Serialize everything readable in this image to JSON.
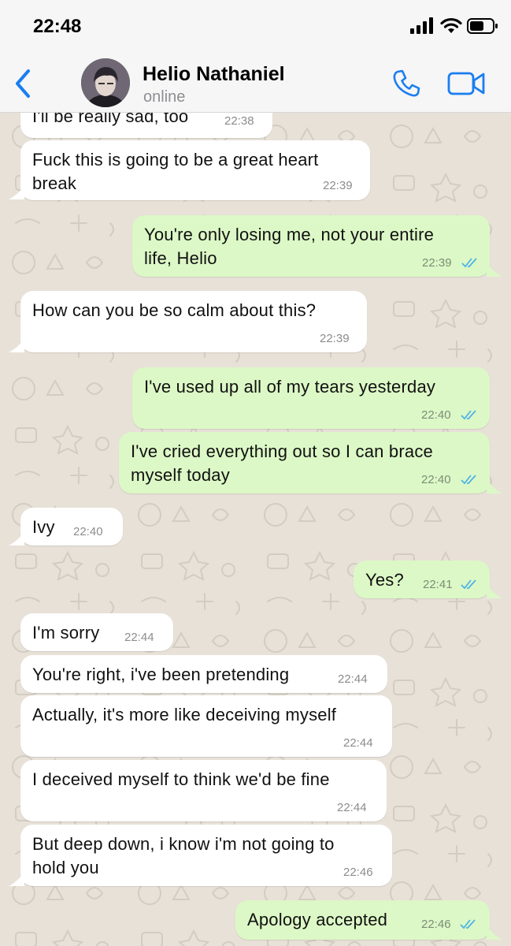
{
  "status_bar": {
    "time": "22:48"
  },
  "header": {
    "contact_name": "Helio Nathaniel",
    "contact_status": "online"
  },
  "icons": [
    "chevron-left-icon",
    "phone-icon",
    "video-camera-icon",
    "signal-icon",
    "wifi-icon",
    "battery-icon",
    "double-check-icon"
  ],
  "colors": {
    "accent": "#1a7ef0",
    "outgoing_bubble": "#dcf8c6",
    "incoming_bubble": "#ffffff",
    "read_ticks": "#4fb3e8"
  },
  "messages": [
    {
      "dir": "in",
      "text": "I'll be really sad, too",
      "time": "22:38"
    },
    {
      "dir": "in",
      "text": "Fuck this is going to be a great heart\nbreak",
      "time": "22:39"
    },
    {
      "dir": "out",
      "text": "You're only losing me, not your entire\nlife, Helio",
      "time": "22:39"
    },
    {
      "dir": "in",
      "text": "How can you be so calm about this?",
      "time": "22:39"
    },
    {
      "dir": "out",
      "text": "I've used up all of my tears yesterday",
      "time": "22:40"
    },
    {
      "dir": "out",
      "text": "I've cried everything out so I can brace\nmyself today",
      "time": "22:40"
    },
    {
      "dir": "in",
      "text": "Ivy",
      "time": "22:40"
    },
    {
      "dir": "out",
      "text": "Yes?",
      "time": "22:41"
    },
    {
      "dir": "in",
      "text": "I'm sorry",
      "time": "22:44"
    },
    {
      "dir": "in",
      "text": "You're right, i've been pretending",
      "time": "22:44"
    },
    {
      "dir": "in",
      "text": "Actually, it's more like deceiving myself",
      "time": "22:44"
    },
    {
      "dir": "in",
      "text": "I deceived myself to think we'd be fine",
      "time": "22:44"
    },
    {
      "dir": "in",
      "text": "But deep down, i know i'm not going to\nhold you",
      "time": "22:46"
    },
    {
      "dir": "out",
      "text": "Apology accepted",
      "time": "22:46"
    }
  ]
}
